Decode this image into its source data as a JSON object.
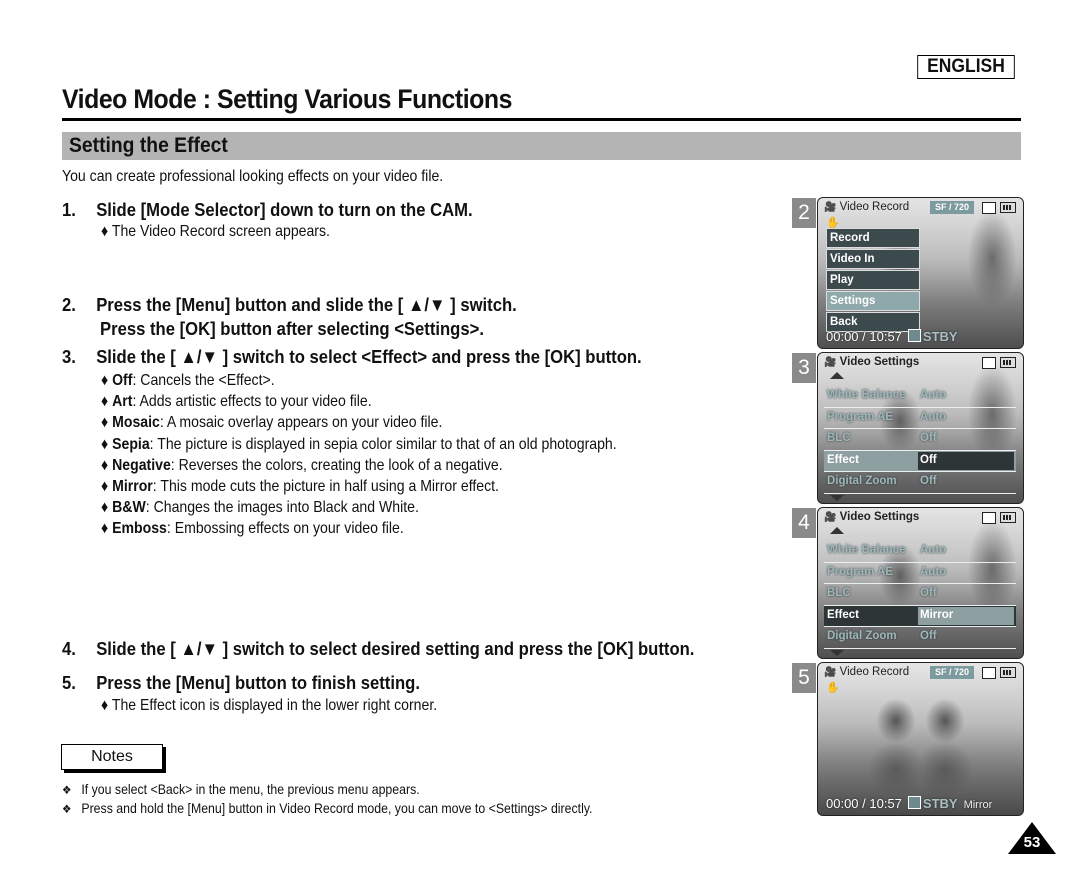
{
  "header": {
    "language": "ENGLISH",
    "title": "Video Mode : Setting Various Functions"
  },
  "section": {
    "title": "Setting the Effect",
    "intro": "You can create professional looking effects on your video file."
  },
  "steps": [
    {
      "num": "1.",
      "lines": [
        "Slide [Mode Selector] down to turn on the CAM."
      ],
      "subs": [
        "♦ The Video Record screen appears."
      ]
    },
    {
      "num": "2.",
      "lines": [
        "Press the [Menu] button and slide the [ ▲/▼ ] switch.",
        "Press the [OK] button after selecting <Settings>."
      ],
      "subs": []
    },
    {
      "num": "3.",
      "lines": [
        "Slide the [ ▲/▼ ] switch to select <Effect> and press the [OK] button."
      ],
      "subs": []
    },
    {
      "num": "4.",
      "lines": [
        "Slide the [ ▲/▼ ] switch to select desired setting and press the [OK] button."
      ],
      "subs": []
    },
    {
      "num": "5.",
      "lines": [
        "Press the [Menu] button to finish setting."
      ],
      "subs": [
        "♦ The Effect icon is displayed in the lower right corner."
      ]
    }
  ],
  "effects": [
    {
      "name": "Off",
      "desc": ": Cancels the <Effect>."
    },
    {
      "name": "Art",
      "desc": ": Adds artistic effects to your video file."
    },
    {
      "name": "Mosaic",
      "desc": ": A mosaic overlay appears on your video file."
    },
    {
      "name": "Sepia",
      "desc": ": The picture is displayed in sepia color similar to that of an old photograph."
    },
    {
      "name": "Negative",
      "desc": ": Reverses the colors, creating the look of a negative."
    },
    {
      "name": "Mirror",
      "desc": ": This mode cuts the picture in half using a Mirror effect."
    },
    {
      "name": "B&W",
      "desc": ": Changes the images into Black and White."
    },
    {
      "name": "Emboss",
      "desc": ": Embossing effects on your video file."
    }
  ],
  "bullet_glyph": "♦",
  "notes": {
    "label": "Notes",
    "mark": "❖",
    "items": [
      "If you select <Back> in the menu, the previous menu appears.",
      "Press and hold the [Menu] button in Video Record mode, you can move to <Settings> directly."
    ]
  },
  "screens": {
    "s2": {
      "num": "2",
      "title": "Video Record",
      "resolution": "SF  /  720",
      "menu": [
        "Record",
        "Video In",
        "Play",
        "Settings",
        "Back"
      ],
      "selected": "Settings",
      "time": "00:00 / 10:57",
      "status": "STBY"
    },
    "s3": {
      "num": "3",
      "title": "Video Settings",
      "rows": [
        {
          "key": "White Balance",
          "value": "Auto"
        },
        {
          "key": "Program AE",
          "value": "Auto"
        },
        {
          "key": "BLC",
          "value": "Off"
        },
        {
          "key": "Effect",
          "value": "Off"
        },
        {
          "key": "Digital Zoom",
          "value": "Off"
        }
      ]
    },
    "s4": {
      "num": "4",
      "title": "Video Settings",
      "rows": [
        {
          "key": "White Balance",
          "value": "Auto"
        },
        {
          "key": "Program AE",
          "value": "Auto"
        },
        {
          "key": "BLC",
          "value": "Off"
        },
        {
          "key": "Effect",
          "value": "Mirror"
        },
        {
          "key": "Digital Zoom",
          "value": "Off"
        }
      ]
    },
    "s5": {
      "num": "5",
      "title": "Video Record",
      "resolution": "SF  /  720",
      "time": "00:00 / 10:57",
      "status": "STBY",
      "effect": "Mirror"
    },
    "camera_icon": "🎥",
    "osd_accent": "#7d9a9e"
  },
  "page_number": "53"
}
